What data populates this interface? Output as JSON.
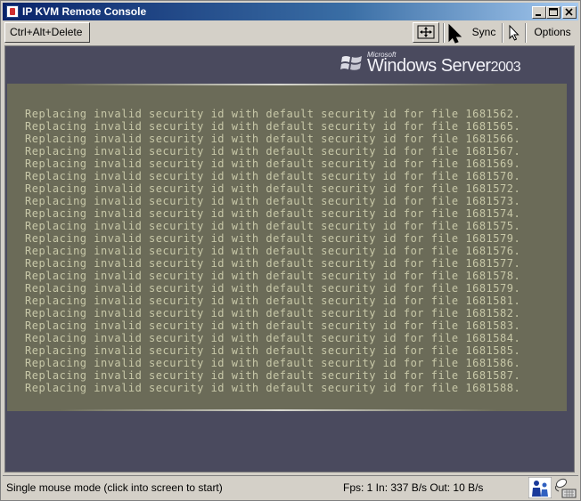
{
  "window": {
    "title": "IP KVM Remote Console",
    "controls": {
      "minimize_icon": "minimize-icon",
      "maximize_icon": "maximize-icon",
      "close_icon": "close-icon"
    }
  },
  "toolbar": {
    "ctrl_alt_del_label": "Ctrl+Alt+Delete",
    "fit_icon": "fit-screen-icon",
    "sync_label": "Sync",
    "options_label": "Options"
  },
  "screen": {
    "logo": {
      "microsoft": "Microsoft",
      "brand": "Windows Server",
      "year": "2003"
    },
    "console_lines": [
      "Replacing invalid security id with default security id for file 1681562.",
      "Replacing invalid security id with default security id for file 1681565.",
      "Replacing invalid security id with default security id for file 1681566.",
      "Replacing invalid security id with default security id for file 1681567.",
      "Replacing invalid security id with default security id for file 1681569.",
      "Replacing invalid security id with default security id for file 1681570.",
      "Replacing invalid security id with default security id for file 1681572.",
      "Replacing invalid security id with default security id for file 1681573.",
      "Replacing invalid security id with default security id for file 1681574.",
      "Replacing invalid security id with default security id for file 1681575.",
      "Replacing invalid security id with default security id for file 1681579.",
      "Replacing invalid security id with default security id for file 1681576.",
      "Replacing invalid security id with default security id for file 1681577.",
      "Replacing invalid security id with default security id for file 1681578.",
      "Replacing invalid security id with default security id for file 1681579.",
      "Replacing invalid security id with default security id for file 1681581.",
      "Replacing invalid security id with default security id for file 1681582.",
      "Replacing invalid security id with default security id for file 1681583.",
      "Replacing invalid security id with default security id for file 1681584.",
      "Replacing invalid security id with default security id for file 1681585.",
      "Replacing invalid security id with default security id for file 1681586.",
      "Replacing invalid security id with default security id for file 1681587.",
      "Replacing invalid security id with default security id for file 1681588."
    ]
  },
  "status": {
    "mode_text": "Single mouse mode (click into screen to start)",
    "stats_text": "Fps: 1 In: 337 B/s Out: 10 B/s"
  },
  "colors": {
    "titlebar_start": "#0a246a",
    "screen_bg": "#4a4a5e",
    "console_bg": "#6b6b58",
    "console_text": "#c8c8a8"
  }
}
